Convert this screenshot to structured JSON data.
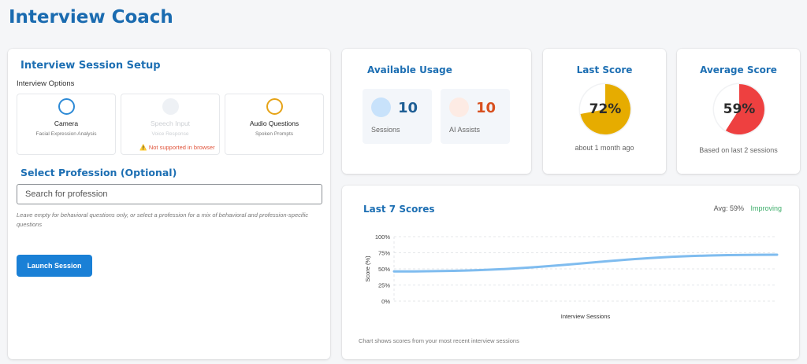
{
  "app": {
    "title": "Interview Coach"
  },
  "setup": {
    "title": "Interview Session Setup",
    "options_label": "Interview Options",
    "options": [
      {
        "title": "Camera",
        "subtitle": "Facial Expression Analysis",
        "state": "available",
        "color": "#2d8ad6"
      },
      {
        "title": "Speech Input",
        "subtitle": "Voice Response",
        "state": "disabled",
        "warning": "⚠️ Not supported in browser"
      },
      {
        "title": "Audio Questions",
        "subtitle": "Spoken Prompts",
        "state": "available",
        "color": "#e6a317"
      }
    ],
    "profession_title": "Select Profession (Optional)",
    "search_placeholder": "Search for profession",
    "help_text": "Leave empty for behavioral questions only, or select a profession for a mix of behavioral and profession-specific questions",
    "launch_label": "Launch Session"
  },
  "usage": {
    "title": "Available Usage",
    "sessions": {
      "value": "10",
      "label": "Sessions"
    },
    "ai_assists": {
      "value": "10",
      "label": "AI Assists"
    }
  },
  "last_score": {
    "title": "Last Score",
    "value": "72%",
    "fraction": 0.72,
    "color": "#e6ac00",
    "subtitle": "about 1 month ago"
  },
  "average_score": {
    "title": "Average Score",
    "value": "59%",
    "fraction": 0.59,
    "color": "#ee4040",
    "subtitle": "Based on last 2 sessions"
  },
  "recent_scores": {
    "title": "Last 7 Scores",
    "avg_label": "Avg: 59%",
    "trend_label": "Improving",
    "footnote": "Chart shows scores from your most recent interview sessions"
  },
  "chart_data": {
    "type": "line",
    "title": "Last 7 Scores",
    "xlabel": "Interview Sessions",
    "ylabel": "Score (%)",
    "yticks": [
      "100%",
      "75%",
      "50%",
      "25%",
      "0%"
    ],
    "ylim": [
      0,
      100
    ],
    "x": [
      1,
      2
    ],
    "series": [
      {
        "values": [
          46,
          72
        ],
        "color": "#7fbcef"
      }
    ],
    "grid": true
  },
  "colors": {
    "accent": "#1a80d6",
    "heading": "#1d6fb3",
    "improving": "#3fae6b",
    "warning": "#e0533a"
  }
}
